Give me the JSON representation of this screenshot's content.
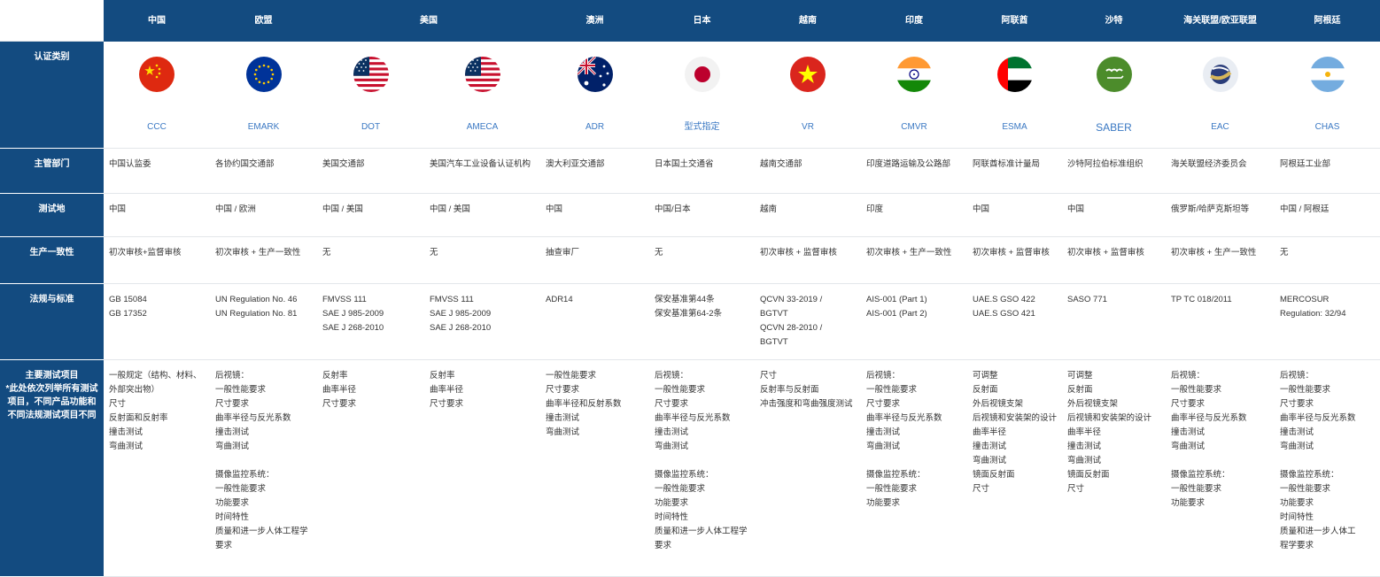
{
  "row_labels": {
    "category": "认证类别",
    "authority": "主管部门",
    "test_site": "测试地",
    "conformity": "生产一致性",
    "standards": "法规与标准",
    "tests": "主要测试项目\n*此处依次列举所有测试项目，不同产品功能和不同法规测试项目不同"
  },
  "countries": [
    {
      "name": "中国",
      "flag": "china-flag",
      "code": "CCC",
      "authority": "中国认监委",
      "site": "中国",
      "conformity": "初次审核+监督审核",
      "standards": "GB 15084\nGB 17352",
      "tests": "一般规定（结构、材料、外部突出物）\n尺寸\n反射面和反射率\n撞击测试\n弯曲测试"
    },
    {
      "name": "欧盟",
      "flag": "eu-flag",
      "code": "EMARK",
      "authority": "各协约国交通部",
      "site": "中国 / 欧洲",
      "conformity": "初次审核 + 生产一致性",
      "standards": "UN Regulation No. 46\nUN Regulation No. 81",
      "tests": "后视镜：\n 一般性能要求\n尺寸要求\n曲率半径与反光系数\n撞击测试\n弯曲测试\n\n摄像监控系统：\n一般性能要求\n功能要求\n时间特性\n质量和进一步人体工程学要求"
    },
    {
      "name": "美国",
      "flag": "usa-flag",
      "code": "DOT",
      "authority": "美国交通部",
      "site": "中国 / 美国",
      "conformity": "无",
      "standards": "FMVSS 111\nSAE J 985-2009\nSAE J 268-2010",
      "tests": "反射率\n曲率半径\n尺寸要求"
    },
    {
      "name": "",
      "flag": "usa-flag",
      "code": "AMECA",
      "authority": "美国汽车工业设备认证机构",
      "site": "中国 / 美国",
      "conformity": "无",
      "standards": "FMVSS 111\nSAE J 985-2009\nSAE J 268-2010",
      "tests": "反射率\n曲率半径\n尺寸要求"
    },
    {
      "name": "澳洲",
      "flag": "australia-flag",
      "code": "ADR",
      "authority": "澳大利亚交通部",
      "site": "中国",
      "conformity": "抽查审厂",
      "standards": "ADR14",
      "tests": "一般性能要求\n尺寸要求\n曲率半径和反射系数\n撞击测试\n弯曲测试"
    },
    {
      "name": "日本",
      "flag": "japan-flag",
      "code": "型式指定",
      "authority": "日本国土交通省",
      "site": "中国/日本",
      "conformity": "无",
      "standards": "保安基准第44条\n保安基准第64-2条",
      "tests": "后视镜：\n一般性能要求\n尺寸要求\n曲率半径与反光系数\n撞击测试\n弯曲测试\n\n摄像监控系统：\n一般性能要求\n功能要求\n时间特性\n质量和进一步人体工程学要求"
    },
    {
      "name": "越南",
      "flag": "vietnam-flag",
      "code": "VR",
      "authority": "越南交通部",
      "site": "越南",
      "conformity": "初次审核 + 监督审核",
      "standards": "QCVN 33-2019 /\nBGTVT\nQCVN 28-2010 /\nBGTVT",
      "tests": "尺寸\n反射率与反射面\n冲击强度和弯曲强度测试"
    },
    {
      "name": "印度",
      "flag": "india-flag",
      "code": "CMVR",
      "authority": "印度道路运输及公路部",
      "site": "印度",
      "conformity": "初次审核 + 生产一致性",
      "standards": "AIS-001 (Part 1)\nAIS-001 (Part 2)",
      "tests": "后视镜：\n一般性能要求\n尺寸要求\n曲率半径与反光系数\n撞击测试\n弯曲测试\n\n摄像监控系统：\n一般性能要求\n功能要求"
    },
    {
      "name": "阿联酋",
      "flag": "uae-flag",
      "code": "ESMA",
      "authority": "阿联酋标准计量局",
      "site": "中国",
      "conformity": "初次审核 + 监督审核",
      "standards": "UAE.S GSO 422\nUAE.S GSO 421",
      "tests": "可调整\n反射面\n外后视镜支架\n后视镜和安装架的设计\n曲率半径\n撞击测试\n弯曲测试\n镜面反射面\n尺寸"
    },
    {
      "name": "沙特",
      "flag": "saudi-flag",
      "code": "SABER",
      "authority": "沙特阿拉伯标准组织",
      "site": "中国",
      "conformity": "初次审核 + 监督审核",
      "standards": "SASO 771",
      "tests": "可调整\n反射面\n外后视镜支架\n后视镜和安装架的设计\n曲率半径\n撞击测试\n弯曲测试\n镜面反射面\n尺寸"
    },
    {
      "name": "海关联盟/欧亚联盟",
      "flag": "eac-flag",
      "code": "EAC",
      "authority": "海关联盟经济委员会",
      "site": "俄罗斯/哈萨克斯坦等",
      "conformity": "初次审核 + 生产一致性",
      "standards": "TP TC 018/2011",
      "tests": "后视镜：\n一般性能要求\n尺寸要求\n曲率半径与反光系数\n撞击测试\n弯曲测试\n\n摄像监控系统：\n一般性能要求\n功能要求"
    },
    {
      "name": "阿根廷",
      "flag": "argentina-flag",
      "code": "CHAS",
      "authority": "阿根廷工业部",
      "site": "中国 / 阿根廷",
      "conformity": "无",
      "standards": "MERCOSUR\nRegulation: 32/94",
      "tests": "后视镜：\n一般性能要求\n尺寸要求\n曲率半径与反光系数\n撞击测试\n弯曲测试\n\n摄像监控系统：\n一般性能要求\n功能要求\n时间特性\n质量和进一步人体工\n程学要求"
    }
  ],
  "colors": {
    "header_bg": "#134b80",
    "code_text": "#3a78c3",
    "body_text": "#333333"
  }
}
